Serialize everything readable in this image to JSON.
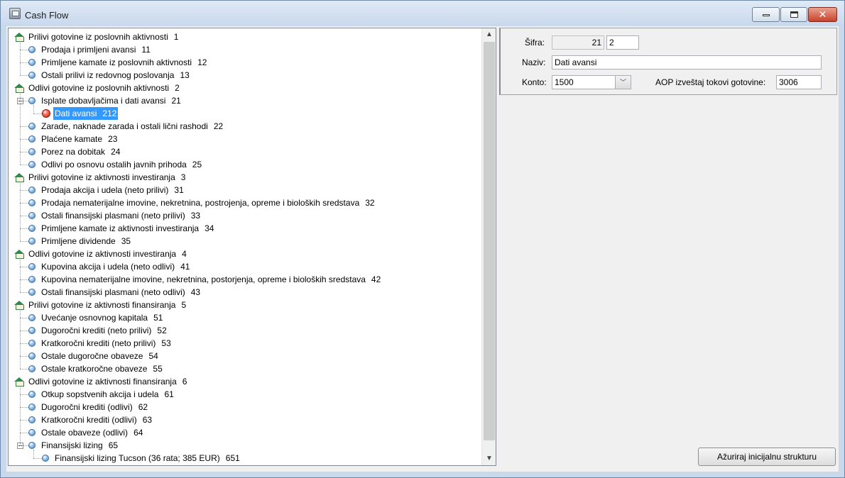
{
  "window": {
    "title": "Cash Flow"
  },
  "tree": {
    "rows": [
      {
        "label": "Prilivi gotovine iz poslovnih aktivnosti",
        "code": "1",
        "level": 0
      },
      {
        "label": "Prodaja i primljeni avansi",
        "code": "11",
        "level": 1
      },
      {
        "label": "Primljene kamate iz poslovnih aktivnosti",
        "code": "12",
        "level": 1
      },
      {
        "label": "Ostali prilivi iz redovnog poslovanja",
        "code": "13",
        "level": 1
      },
      {
        "label": "Odlivi gotovine iz poslovnih aktivnosti",
        "code": "2",
        "level": 0
      },
      {
        "label": "Isplate dobavljačima i dati avansi",
        "code": "21",
        "level": 1,
        "expanded": true
      },
      {
        "label": "Dati avansi",
        "code": "212",
        "level": 2,
        "selected": true
      },
      {
        "label": "Zarade, naknade zarada i ostali lični rashodi",
        "code": "22",
        "level": 1
      },
      {
        "label": "Plaćene kamate",
        "code": "23",
        "level": 1
      },
      {
        "label": "Porez na dobitak",
        "code": "24",
        "level": 1
      },
      {
        "label": "Odlivi po osnovu ostalih javnih prihoda",
        "code": "25",
        "level": 1
      },
      {
        "label": "Prilivi gotovine iz aktivnosti investiranja",
        "code": "3",
        "level": 0
      },
      {
        "label": "Prodaja akcija i udela (neto prilivi)",
        "code": "31",
        "level": 1
      },
      {
        "label": "Prodaja nematerijalne imovine, nekretnina, postrojenja, opreme i bioloških sredstava",
        "code": "32",
        "level": 1
      },
      {
        "label": "Ostali finansijski plasmani (neto prilivi)",
        "code": "33",
        "level": 1
      },
      {
        "label": "Primljene kamate iz aktivnosti investiranja",
        "code": "34",
        "level": 1
      },
      {
        "label": "Primljene dividende",
        "code": "35",
        "level": 1
      },
      {
        "label": "Odlivi gotovine iz aktivnosti investiranja",
        "code": "4",
        "level": 0
      },
      {
        "label": "Kupovina akcija i udela (neto odlivi)",
        "code": "41",
        "level": 1
      },
      {
        "label": "Kupovina nematerijalne imovine, nekretnina, postorjenja, opreme i bioloških sredstava",
        "code": "42",
        "level": 1
      },
      {
        "label": "Ostali finansijski plasmani (neto odlivi)",
        "code": "43",
        "level": 1
      },
      {
        "label": "Prilivi gotovine iz aktivnosti finansiranja",
        "code": "5",
        "level": 0
      },
      {
        "label": "Uvećanje osnovnog kapitala",
        "code": "51",
        "level": 1
      },
      {
        "label": "Dugoročni krediti (neto prilivi)",
        "code": "52",
        "level": 1
      },
      {
        "label": "Kratkoročni krediti (neto prilivi)",
        "code": "53",
        "level": 1
      },
      {
        "label": "Ostale dugoročne obaveze",
        "code": "54",
        "level": 1
      },
      {
        "label": "Ostale kratkoročne obaveze",
        "code": "55",
        "level": 1
      },
      {
        "label": "Odlivi gotovine iz aktivnosti finansiranja",
        "code": "6",
        "level": 0
      },
      {
        "label": "Otkup sopstvenih akcija i udela",
        "code": "61",
        "level": 1
      },
      {
        "label": "Dugoročni krediti (odlivi)",
        "code": "62",
        "level": 1
      },
      {
        "label": "Kratkoročni krediti (odlivi)",
        "code": "63",
        "level": 1
      },
      {
        "label": "Ostale obaveze (odlivi)",
        "code": "64",
        "level": 1
      },
      {
        "label": "Finansijski lizing",
        "code": "65",
        "level": 1,
        "expanded": true
      },
      {
        "label": "Finansijski lizing Tucson (36 rata; 385 EUR)",
        "code": "651",
        "level": 2
      }
    ]
  },
  "form": {
    "sifra_label": "Šifra:",
    "sifra_prefix": "21",
    "sifra_value": "2",
    "naziv_label": "Naziv:",
    "naziv_value": "Dati avansi",
    "konto_label": "Konto:",
    "konto_value": "1500",
    "aop_label": "AOP izveštaj tokovi gotovine:",
    "aop_value": "3006"
  },
  "actions": {
    "update_structure_label": "Ažuriraj inicijalnu strukturu"
  }
}
